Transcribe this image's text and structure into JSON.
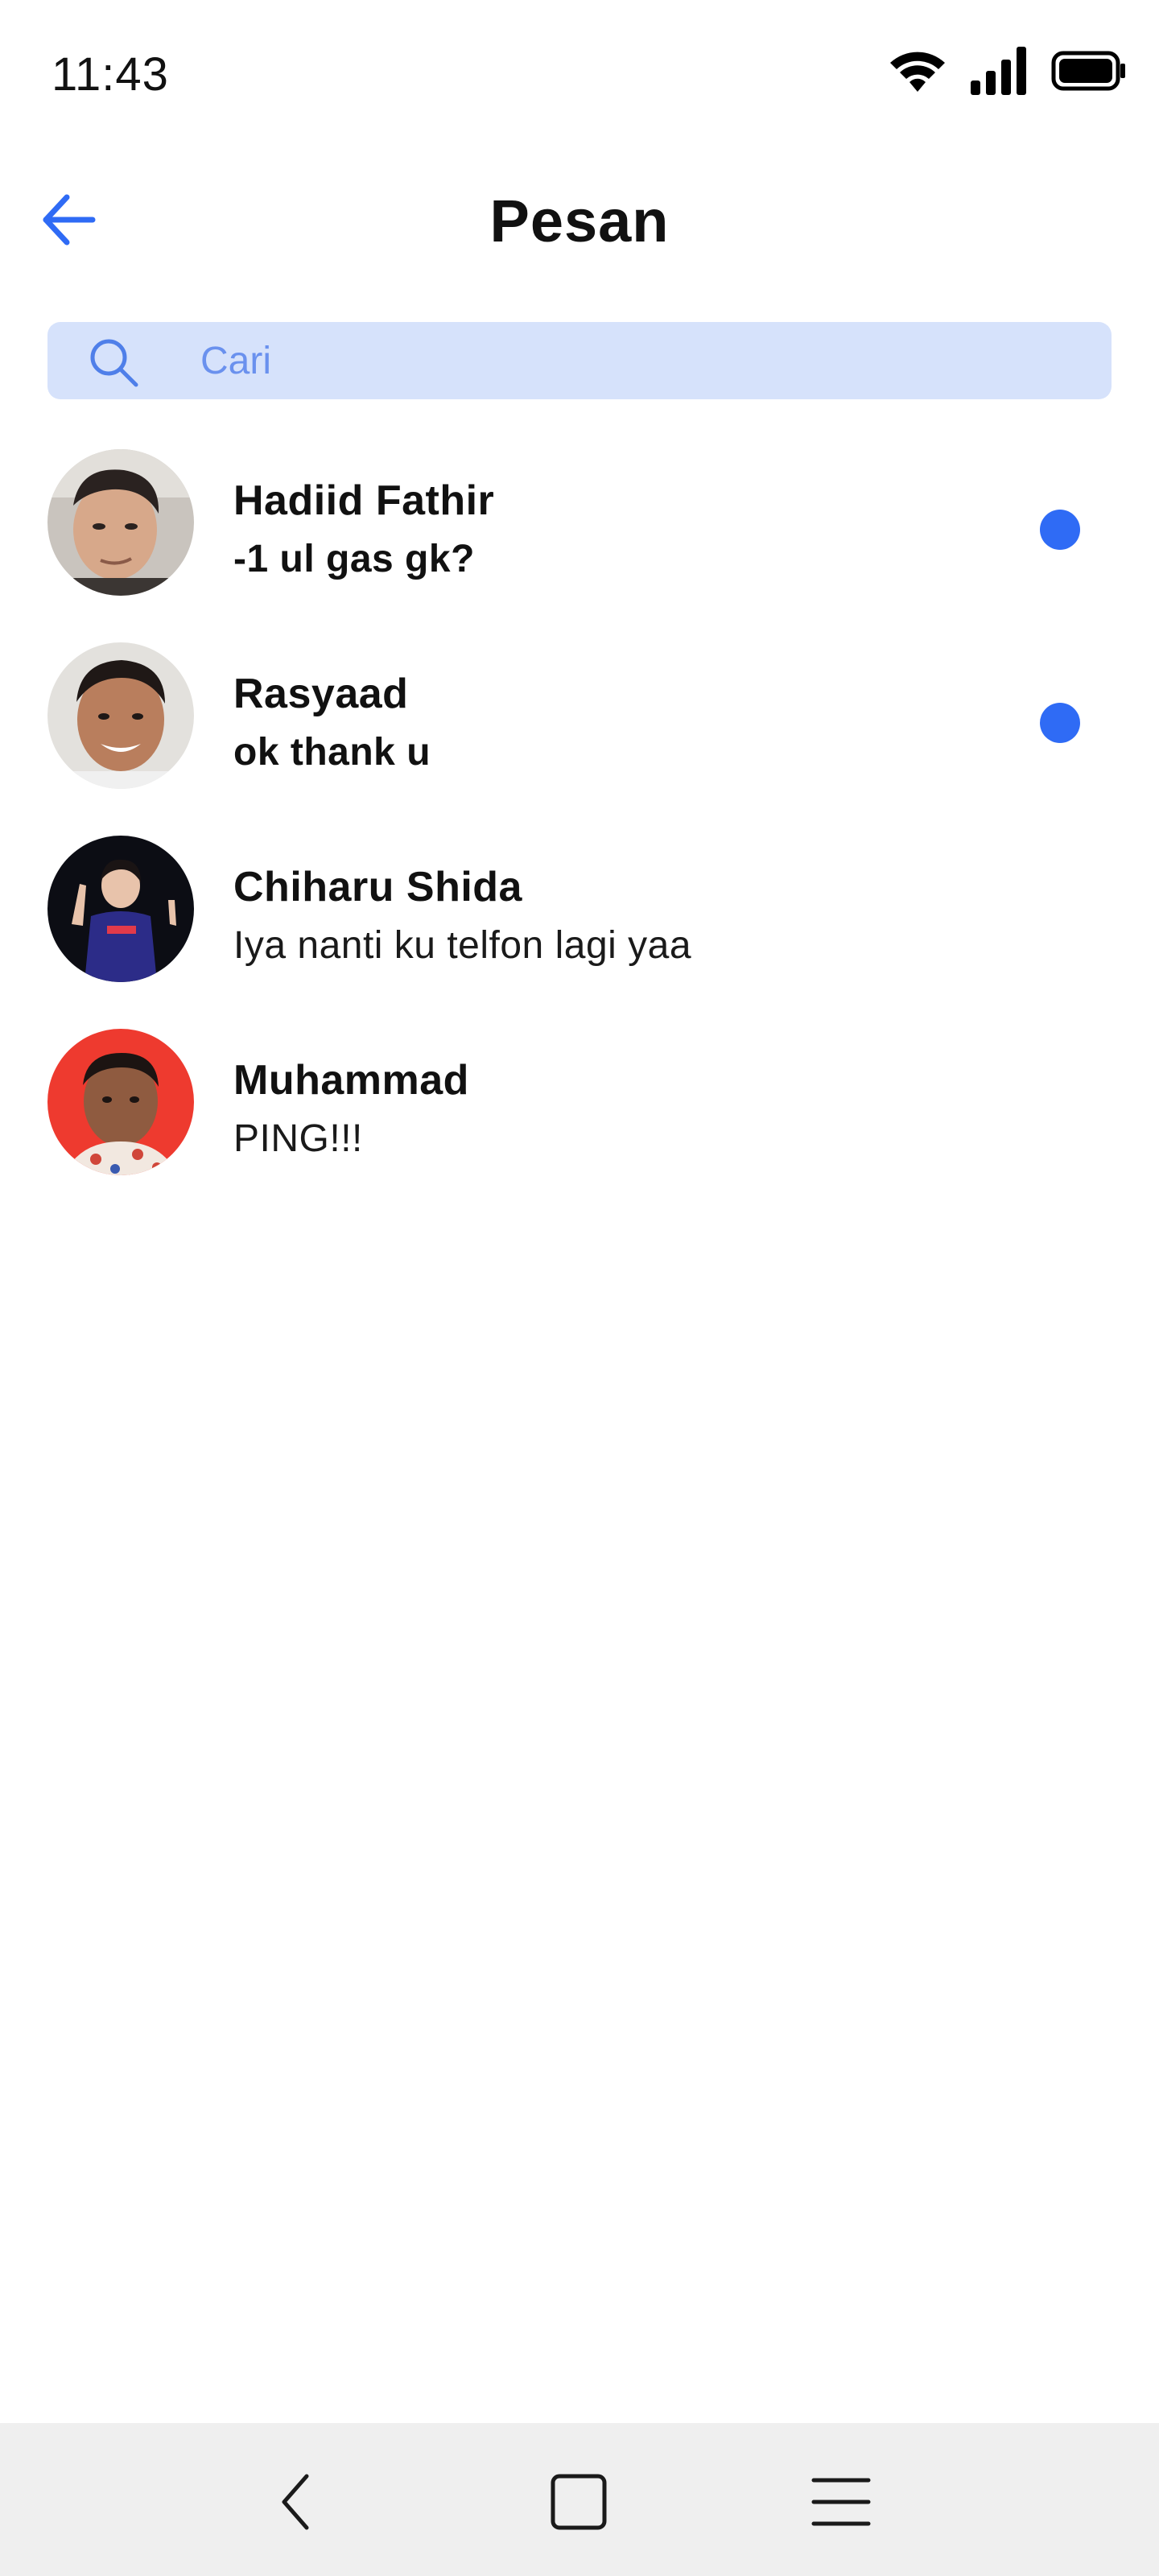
{
  "status_bar": {
    "time": "11:43",
    "icons": [
      "wifi-icon",
      "signal-icon",
      "battery-icon"
    ]
  },
  "header": {
    "title": "Pesan",
    "back_icon": "arrow-left-icon"
  },
  "search": {
    "placeholder": "Cari",
    "value": "",
    "icon": "search-icon"
  },
  "conversations": [
    {
      "name": "Hadiid Fathir",
      "message": "-1 ul gas gk?",
      "unread": true
    },
    {
      "name": "Rasyaad",
      "message": "ok thank u",
      "unread": true
    },
    {
      "name": "Chiharu Shida",
      "message": "Iya nanti ku telfon lagi yaa",
      "unread": false
    },
    {
      "name": "Muhammad",
      "message": "PING!!!",
      "unread": false
    }
  ],
  "nav_bar": {
    "buttons": [
      "back-nav-icon",
      "home-nav-icon",
      "recents-nav-icon"
    ]
  },
  "colors": {
    "accent": "#2f6bf5",
    "search_bg": "#d6e2fb",
    "nav_bg": "#efefef"
  }
}
